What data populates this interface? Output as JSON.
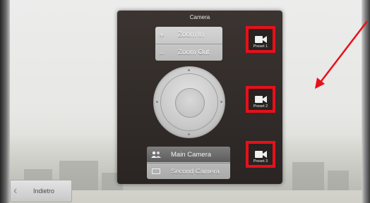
{
  "panel": {
    "title": "Camera"
  },
  "zoom": {
    "in_label": "Zoom In",
    "out_label": "Zoom Out"
  },
  "cameras": {
    "main_label": "Main Camera",
    "second_label": "Second Camera"
  },
  "presets": [
    {
      "label": "Preset 1"
    },
    {
      "label": "Preset 2"
    },
    {
      "label": "Preset 3"
    }
  ],
  "back": {
    "label": "Indietro"
  },
  "colors": {
    "highlight": "#e8101a",
    "arrow": "#e8101a",
    "panel": "#2e2826"
  }
}
